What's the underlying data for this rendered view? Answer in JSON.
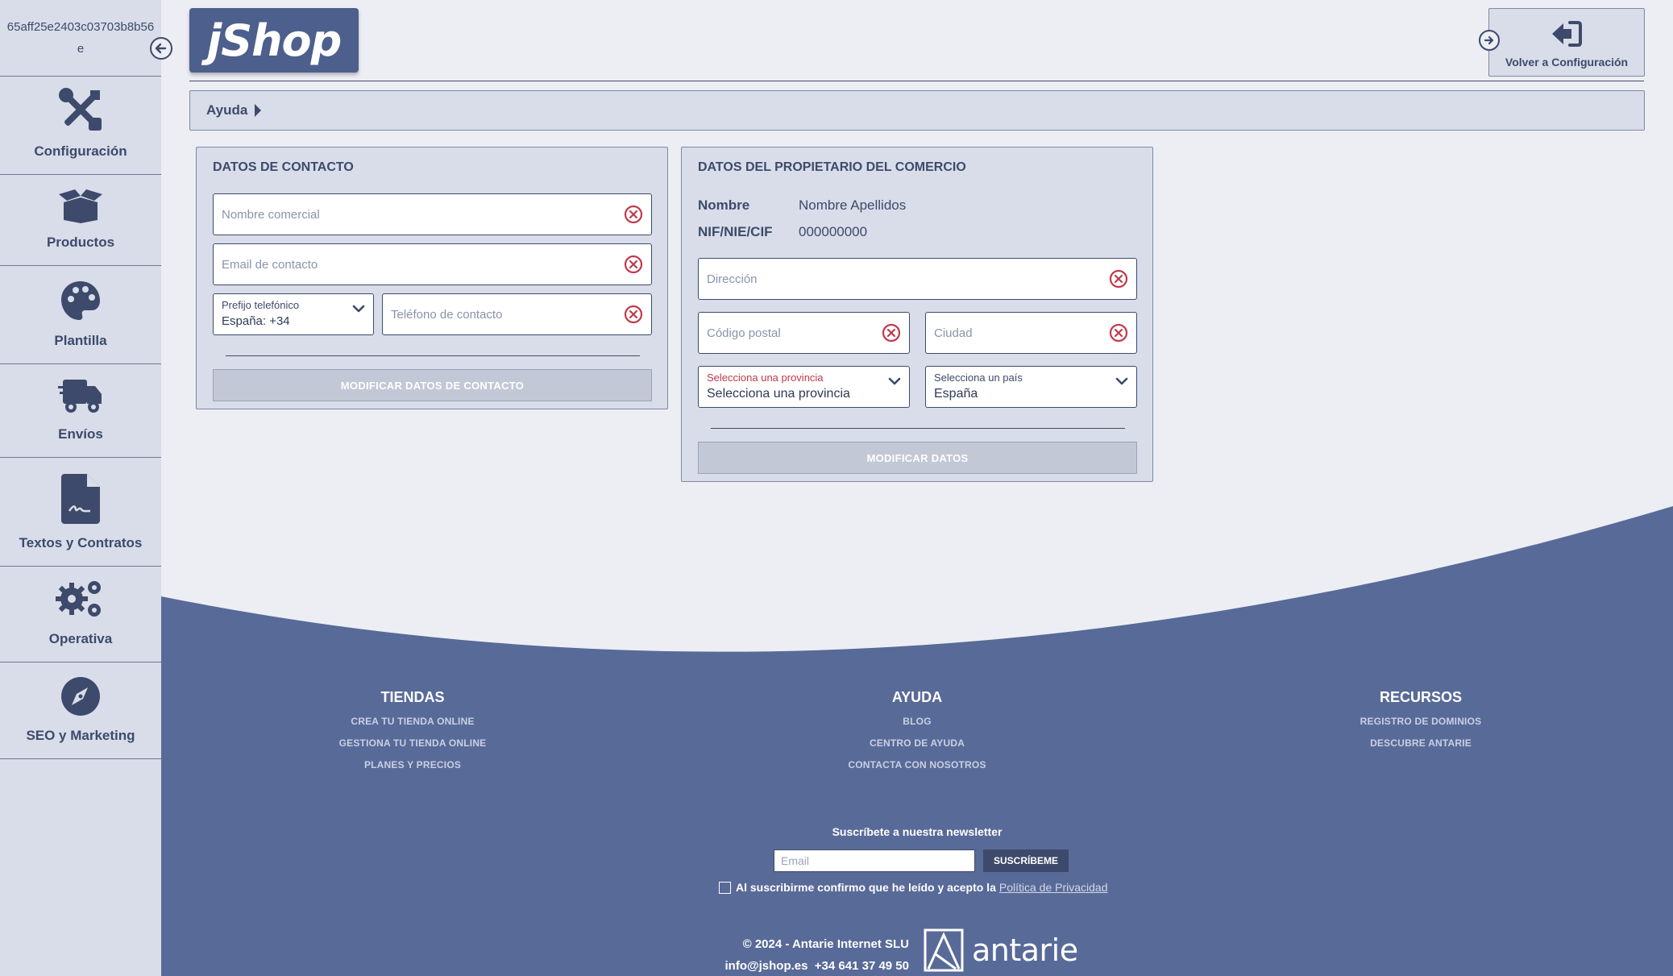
{
  "sidebar": {
    "store_id": "65aff25e2403c03703b8b56e",
    "items": [
      {
        "label": "Configuración",
        "icon": "tools-icon"
      },
      {
        "label": "Productos",
        "icon": "box-icon"
      },
      {
        "label": "Plantilla",
        "icon": "palette-icon"
      },
      {
        "label": "Envíos",
        "icon": "truck-icon"
      },
      {
        "label": "Textos y Contratos",
        "icon": "contract-icon"
      },
      {
        "label": "Operativa",
        "icon": "gears-icon"
      },
      {
        "label": "SEO y Marketing",
        "icon": "compass-icon"
      }
    ]
  },
  "header": {
    "logo_text": "jShop",
    "back_label": "Volver a Configuración"
  },
  "help": {
    "label": "Ayuda"
  },
  "contact": {
    "title": "DATOS DE CONTACTO",
    "trade_name_placeholder": "Nombre comercial",
    "email_placeholder": "Email de contacto",
    "prefix_label": "Prefijo telefónico",
    "prefix_value": "España: +34",
    "phone_placeholder": "Teléfono de contacto",
    "submit_label": "MODIFICAR DATOS DE CONTACTO"
  },
  "owner": {
    "title": "DATOS DEL PROPIETARIO DEL COMERCIO",
    "name_key": "Nombre",
    "name_value": "Nombre Apellidos",
    "nif_key": "NIF/NIE/CIF",
    "nif_value": "000000000",
    "address_placeholder": "Dirección",
    "postal_placeholder": "Código postal",
    "city_placeholder": "Ciudad",
    "province_label": "Selecciona una provincia",
    "province_value": "Selecciona una provincia",
    "country_label": "Selecciona un país",
    "country_value": "España",
    "submit_label": "MODIFICAR DATOS"
  },
  "footer": {
    "col_tiendas": {
      "title": "TIENDAS",
      "links": [
        "CREA TU TIENDA ONLINE",
        "GESTIONA TU TIENDA ONLINE",
        "PLANES Y PRECIOS"
      ]
    },
    "col_ayuda": {
      "title": "AYUDA",
      "links": [
        "BLOG",
        "CENTRO DE AYUDA",
        "CONTACTA CON NOSOTROS"
      ]
    },
    "col_recursos": {
      "title": "RECURSOS",
      "links": [
        "REGISTRO DE DOMINIOS",
        "DESCUBRE ANTARIE"
      ]
    },
    "newsletter_title": "Suscríbete a nuestra newsletter",
    "newsletter_placeholder": "Email",
    "newsletter_button": "SUSCRÍBEME",
    "consent_text": "Al suscribirme confirmo que he leído y acepto la",
    "consent_link": "Política de Privacidad",
    "copyright": "© 2024 - Antarie Internet SLU",
    "contact_line": "info@jshop.es  +34 641 37 49 50",
    "brand": "antarie"
  },
  "colors": {
    "primary": "#3d4a6b",
    "footer_blue": "#586a98",
    "panel_bg": "#d8dde9",
    "page_bg": "#eceef4",
    "error_red": "#c0394b"
  }
}
